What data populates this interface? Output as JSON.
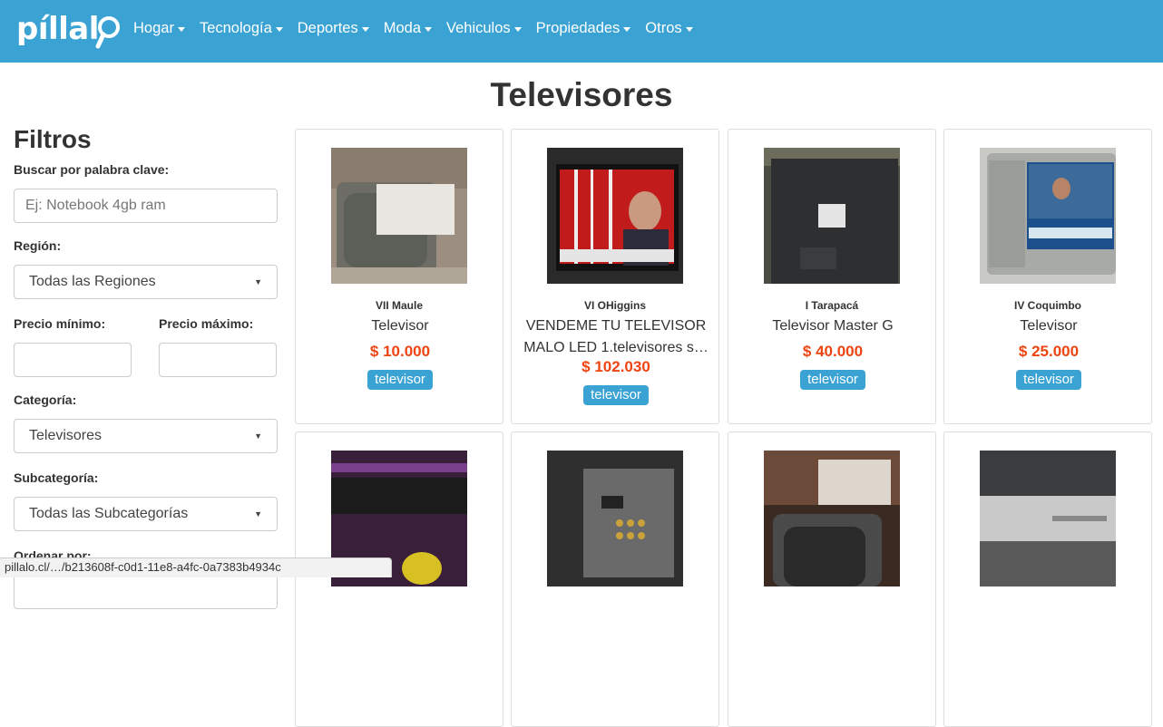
{
  "brand": {
    "logo_text": "píllal",
    "accent": "#3aa3d4",
    "price_color": "#ee4411"
  },
  "nav": {
    "items": [
      {
        "label": "Hogar"
      },
      {
        "label": "Tecnología"
      },
      {
        "label": "Deportes"
      },
      {
        "label": "Moda"
      },
      {
        "label": "Vehiculos"
      },
      {
        "label": "Propiedades"
      },
      {
        "label": "Otros"
      }
    ]
  },
  "page": {
    "title": "Televisores"
  },
  "filters": {
    "title": "Filtros",
    "keyword_label": "Buscar por palabra clave:",
    "keyword_placeholder": "Ej: Notebook 4gb ram",
    "region_label": "Región:",
    "region_value": "Todas las Regiones",
    "price_min_label": "Precio mínimo:",
    "price_max_label": "Precio máximo:",
    "category_label": "Categoría:",
    "category_value": "Televisores",
    "subcategory_label": "Subcategoría:",
    "subcategory_value": "Todas las Subcategorías",
    "order_label": "Ordenar por:"
  },
  "products": [
    {
      "region": "VII Maule",
      "title": "Televisor",
      "price": "$ 10.000",
      "tag": "televisor"
    },
    {
      "region": "VI OHiggins",
      "title": "VENDEME TU TELEVISOR MALO LED 1.televisores s…",
      "price": "$ 102.030",
      "tag": "televisor"
    },
    {
      "region": "I Tarapacá",
      "title": "Televisor Master G",
      "price": "$ 40.000",
      "tag": "televisor"
    },
    {
      "region": "IV Coquimbo",
      "title": "Televisor",
      "price": "$ 25.000",
      "tag": "televisor"
    }
  ],
  "statusbar": {
    "url": "pillalo.cl/…/b213608f-c0d1-11e8-a4fc-0a7383b4934c"
  }
}
